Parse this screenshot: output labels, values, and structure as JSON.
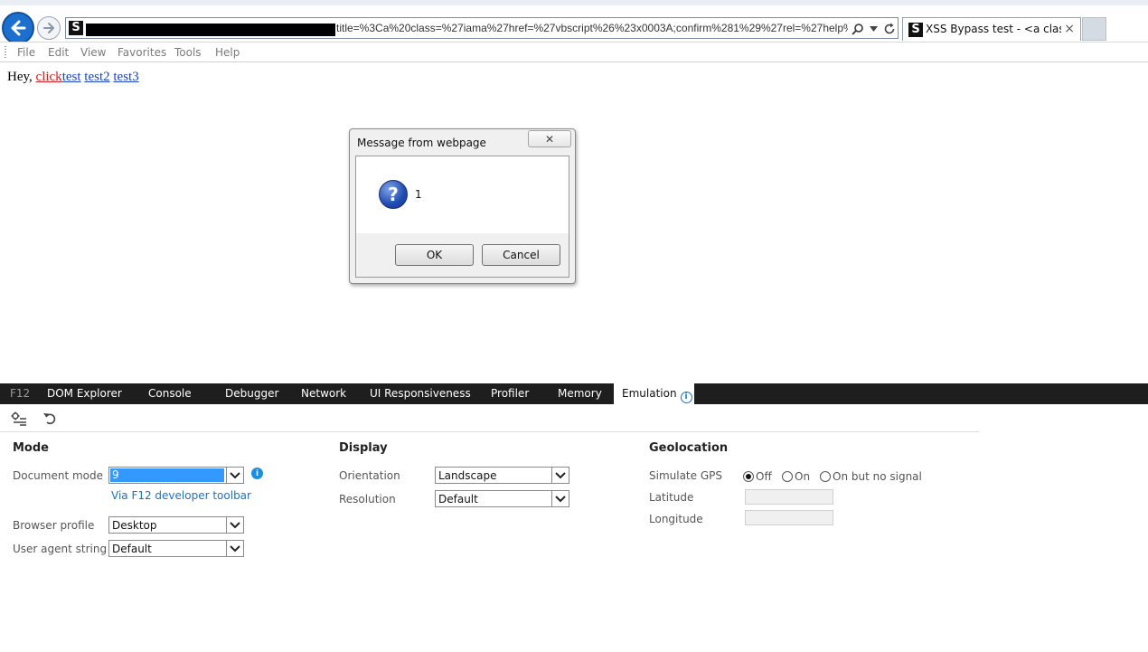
{
  "browser": {
    "address_url": "title=%3Ca%20class=%27iama%27href=%27vbscript%26%23x0003A;confirm%281%29%27rel=%27help%27I",
    "favicon_letter": "S",
    "tab_title": "XSS Bypass test - <a class='...",
    "tab_close": "×"
  },
  "menu": {
    "items": [
      "File",
      "Edit",
      "View",
      "Favorites",
      "Tools",
      "Help"
    ]
  },
  "page": {
    "greeting": "Hey, ",
    "link1": "click",
    "link2": "test",
    "link3": "test2",
    "link4": "test3"
  },
  "dialog": {
    "title": "Message from webpage",
    "close_glyph": "✕",
    "icon_glyph": "?",
    "message": "1",
    "ok_label": "OK",
    "cancel_label": "Cancel"
  },
  "f12": {
    "label": "F12",
    "tabs": [
      "DOM Explorer",
      "Console",
      "Debugger",
      "Network",
      "UI Responsiveness",
      "Profiler",
      "Memory"
    ],
    "active_tab": "Emulation",
    "info_glyph": "i",
    "mode": {
      "heading": "Mode",
      "document_mode_label": "Document mode",
      "document_mode_value": "9",
      "via_link": "Via F12 developer toolbar",
      "browser_profile_label": "Browser profile",
      "browser_profile_value": "Desktop",
      "user_agent_label": "User agent string",
      "user_agent_value": "Default"
    },
    "display": {
      "heading": "Display",
      "orientation_label": "Orientation",
      "orientation_value": "Landscape",
      "resolution_label": "Resolution",
      "resolution_value": "Default"
    },
    "geolocation": {
      "heading": "Geolocation",
      "simulate_gps_label": "Simulate GPS",
      "options": [
        "Off",
        "On",
        "On but no signal"
      ],
      "selected": "Off",
      "latitude_label": "Latitude",
      "longitude_label": "Longitude"
    }
  },
  "colors": {
    "accent_blue": "#1a6fcf",
    "link_blue": "#1a44c8",
    "link_red": "#d21f1f",
    "f12_bar": "#1e1e1e",
    "selection": "#3399ff"
  }
}
